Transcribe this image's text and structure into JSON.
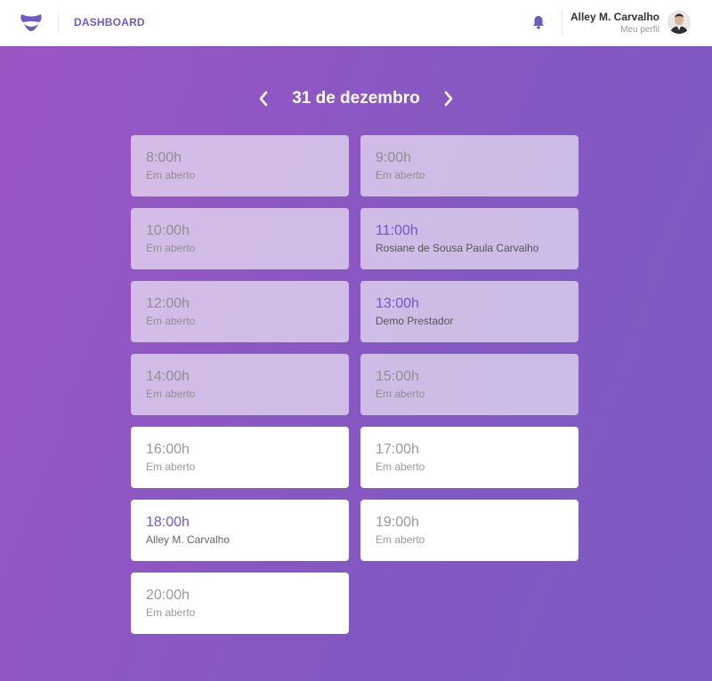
{
  "header": {
    "nav_label": "DASHBOARD",
    "profile_name": "Alley M. Carvalho",
    "profile_link": "Meu perfil",
    "brand_color": "#7159c1"
  },
  "date_nav": {
    "label": "31 de dezembro"
  },
  "slots": [
    {
      "time": "8:00h",
      "status": "Em aberto",
      "past": true,
      "booked": false
    },
    {
      "time": "9:00h",
      "status": "Em aberto",
      "past": true,
      "booked": false
    },
    {
      "time": "10:00h",
      "status": "Em aberto",
      "past": true,
      "booked": false
    },
    {
      "time": "11:00h",
      "status": "Rosiane de Sousa Paula Carvalho",
      "past": true,
      "booked": true
    },
    {
      "time": "12:00h",
      "status": "Em aberto",
      "past": true,
      "booked": false
    },
    {
      "time": "13:00h",
      "status": "Demo Prestador",
      "past": true,
      "booked": true
    },
    {
      "time": "14:00h",
      "status": "Em aberto",
      "past": true,
      "booked": false
    },
    {
      "time": "15:00h",
      "status": "Em aberto",
      "past": true,
      "booked": false
    },
    {
      "time": "16:00h",
      "status": "Em aberto",
      "past": false,
      "booked": false
    },
    {
      "time": "17:00h",
      "status": "Em aberto",
      "past": false,
      "booked": false
    },
    {
      "time": "18:00h",
      "status": "Alley M. Carvalho",
      "past": false,
      "booked": true
    },
    {
      "time": "19:00h",
      "status": "Em aberto",
      "past": false,
      "booked": false
    },
    {
      "time": "20:00h",
      "status": "Em aberto",
      "past": false,
      "booked": false
    }
  ],
  "icons": {
    "logo": "mustache-logo-icon",
    "notifications": "bell-icon",
    "prev": "chevron-left-icon",
    "next": "chevron-right-icon"
  }
}
